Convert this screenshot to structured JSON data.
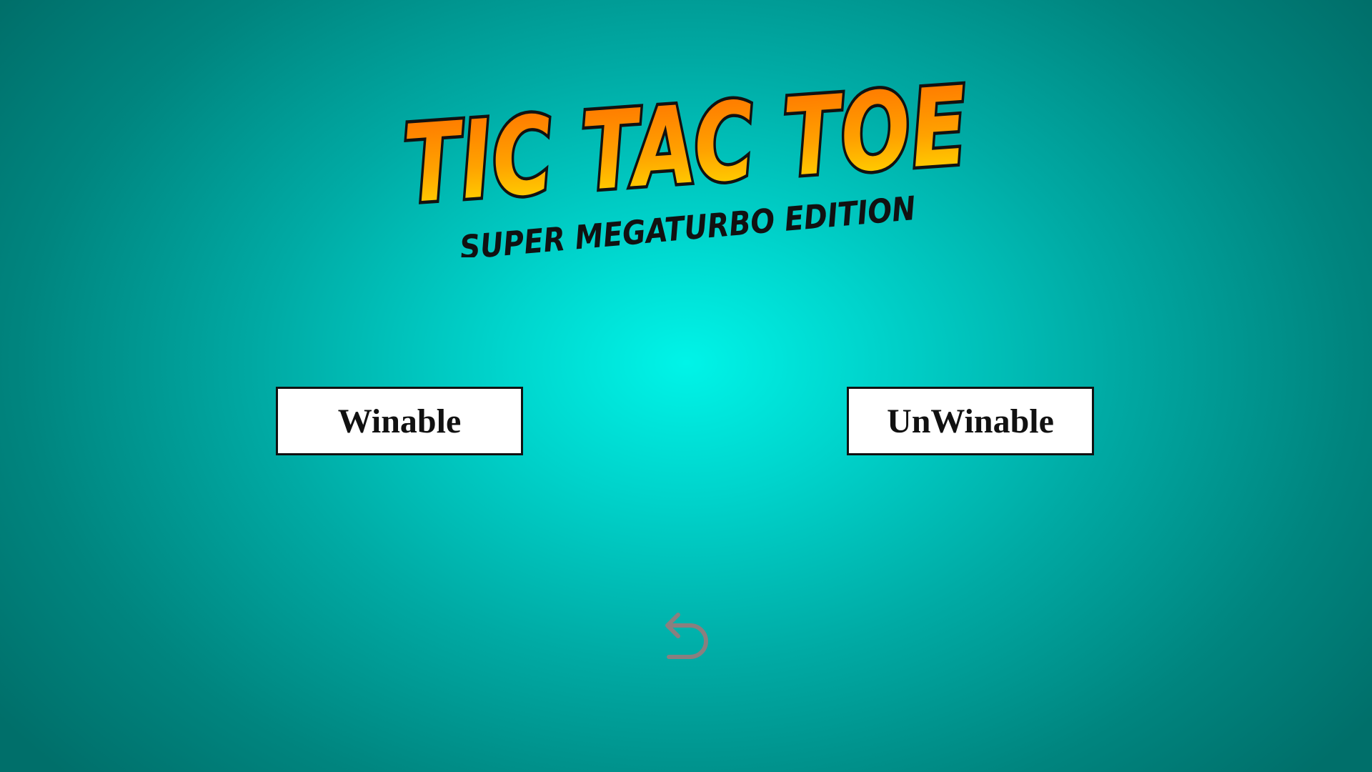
{
  "logo": {
    "title": "TIC TAC TOE",
    "subtitle": "SUPER MEGATURBO EDITION"
  },
  "menu": {
    "winable_label": "Winable",
    "unwinable_label": "UnWinable"
  },
  "back": {
    "icon": "undo-arrow-icon"
  },
  "colors": {
    "background_center": "#00f4e8",
    "background_edge": "#006f6a",
    "logo_orange": "#ff7a00",
    "logo_yellow": "#ffe100",
    "logo_outline": "#111111",
    "button_fill": "#ffffff",
    "icon_gray": "#8a7f7f"
  }
}
